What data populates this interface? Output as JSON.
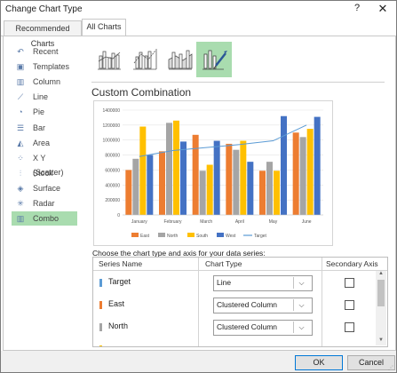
{
  "window": {
    "title": "Change Chart Type",
    "help": "?",
    "close": "✕"
  },
  "tabs": [
    {
      "label": "Recommended Charts"
    },
    {
      "label": "All Charts"
    }
  ],
  "sidebar": {
    "items": [
      {
        "label": "Recent",
        "icon": "recent-icon",
        "glyph": "↶"
      },
      {
        "label": "Templates",
        "icon": "templates-icon",
        "glyph": "▣"
      },
      {
        "label": "Column",
        "icon": "column-chart-icon",
        "glyph": "▥"
      },
      {
        "label": "Line",
        "icon": "line-chart-icon",
        "glyph": "⟋"
      },
      {
        "label": "Pie",
        "icon": "pie-chart-icon",
        "glyph": "◔"
      },
      {
        "label": "Bar",
        "icon": "bar-chart-icon",
        "glyph": "☰"
      },
      {
        "label": "Area",
        "icon": "area-chart-icon",
        "glyph": "◭"
      },
      {
        "label": "X Y (Scatter)",
        "icon": "scatter-chart-icon",
        "glyph": "⁘"
      },
      {
        "label": "Stock",
        "icon": "stock-chart-icon",
        "glyph": "⫶"
      },
      {
        "label": "Surface",
        "icon": "surface-chart-icon",
        "glyph": "◈"
      },
      {
        "label": "Radar",
        "icon": "radar-chart-icon",
        "glyph": "✳"
      },
      {
        "label": "Combo",
        "icon": "combo-chart-icon",
        "glyph": "▥"
      }
    ],
    "selected_index": 11
  },
  "subtypes": [
    {
      "name": "clustered-column-line-icon"
    },
    {
      "name": "clustered-column-line-secondary-icon"
    },
    {
      "name": "stacked-area-clustered-column-icon"
    },
    {
      "name": "custom-combination-icon",
      "selected": true
    }
  ],
  "heading": "Custom Combination",
  "chart_data": {
    "type": "bar",
    "categories": [
      "January",
      "February",
      "March",
      "April",
      "May",
      "June"
    ],
    "series": [
      {
        "name": "East",
        "kind": "column",
        "color": "#ed7d31",
        "values": [
          600000,
          850000,
          1070000,
          950000,
          590000,
          1100000
        ]
      },
      {
        "name": "North",
        "kind": "column",
        "color": "#a5a5a5",
        "values": [
          750000,
          1230000,
          590000,
          870000,
          710000,
          1040000
        ]
      },
      {
        "name": "South",
        "kind": "column",
        "color": "#ffc000",
        "values": [
          1180000,
          1260000,
          670000,
          990000,
          590000,
          1150000
        ]
      },
      {
        "name": "West",
        "kind": "column",
        "color": "#4472c4",
        "values": [
          800000,
          980000,
          990000,
          710000,
          1320000,
          1310000
        ]
      },
      {
        "name": "Target",
        "kind": "line",
        "color": "#5b9bd5",
        "values": [
          780000,
          860000,
          900000,
          940000,
          990000,
          1200000
        ]
      }
    ],
    "yticks": [
      "1400000",
      "1200000",
      "1000000",
      "800000",
      "600000",
      "400000",
      "200000",
      "0"
    ],
    "ylim": [
      0,
      1400000
    ],
    "grid": true,
    "legend_position": "bottom"
  },
  "choose_label": "Choose the chart type and axis for your data series:",
  "table": {
    "headers": {
      "name": "Series Name",
      "type": "Chart Type",
      "axis": "Secondary Axis"
    },
    "rows": [
      {
        "name": "Target",
        "type": "Line",
        "color": "#5b9bd5",
        "secondary": false
      },
      {
        "name": "East",
        "type": "Clustered Column",
        "color": "#ed7d31",
        "secondary": false
      },
      {
        "name": "North",
        "type": "Clustered Column",
        "color": "#a5a5a5",
        "secondary": false
      },
      {
        "name": "",
        "type": "",
        "color": "#ffc000",
        "secondary": false
      }
    ]
  },
  "buttons": {
    "ok": "OK",
    "cancel": "Cancel"
  }
}
